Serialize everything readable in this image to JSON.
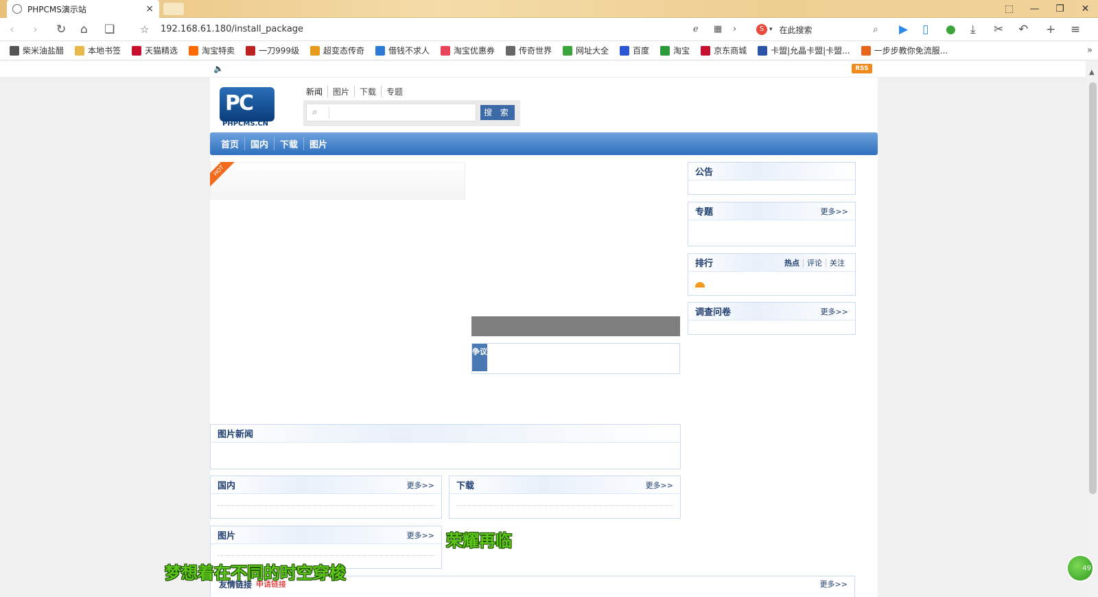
{
  "browser": {
    "tab_title": "PHPCMS演示站",
    "tab_close": "×",
    "url": "192.168.61.180/install_package",
    "search_placeholder": "在此搜索",
    "window_buttons": [
      "⬚",
      "—",
      "❐",
      "✕"
    ],
    "bookmarks": [
      {
        "label": "柴米油盐醋",
        "color": "#555"
      },
      {
        "label": "本地书签",
        "color": "#e8b84a"
      },
      {
        "label": "天猫精选",
        "color": "#c8102e"
      },
      {
        "label": "淘宝特卖",
        "color": "#ff6a00"
      },
      {
        "label": "一刀999级",
        "color": "#b22"
      },
      {
        "label": "超变态传奇",
        "color": "#e89a1c"
      },
      {
        "label": "借钱不求人",
        "color": "#2a7ad6"
      },
      {
        "label": "淘宝优惠券",
        "color": "#e8455a"
      },
      {
        "label": "传奇世界",
        "color": "#666"
      },
      {
        "label": "网址大全",
        "color": "#3aa53a"
      },
      {
        "label": "百度",
        "color": "#2a55d6"
      },
      {
        "label": "淘宝",
        "color": "#2a9a3a"
      },
      {
        "label": "京东商城",
        "color": "#c8102e"
      },
      {
        "label": "卡盟|允晶卡盟|卡盟...",
        "color": "#2a55a6"
      },
      {
        "label": "一步步教你免流服...",
        "color": "#e8651c"
      }
    ],
    "bookmarks_more": "»"
  },
  "site": {
    "rss": "RSS",
    "logo_text": "PHPCMS.CN",
    "logo_mark": "PC",
    "top_links": [
      "新闻",
      "图片",
      "下载",
      "专题"
    ],
    "search_button": "搜 索",
    "nav": [
      "首页",
      "国内",
      "下载",
      "图片"
    ],
    "hot_label": "HOT",
    "zhengyi_label": "争议",
    "right": {
      "notice": {
        "title": "公告"
      },
      "special": {
        "title": "专题",
        "more": "更多>>"
      },
      "ranking": {
        "title": "排行",
        "tabs": [
          "热点",
          "评论",
          "关注"
        ]
      },
      "survey": {
        "title": "调查问卷",
        "more": "更多>>"
      }
    },
    "photo_news": {
      "title": "图片新闻"
    },
    "domestic": {
      "title": "国内",
      "more": "更多>>"
    },
    "download": {
      "title": "下载",
      "more": "更多>>"
    },
    "pictures": {
      "title": "图片",
      "more": "更多>>"
    },
    "friend_links": {
      "title": "友情链接",
      "apply": "申请链接",
      "more": "更多>>"
    }
  },
  "overlay": {
    "text1": "荣耀再临",
    "text2": "梦想着在不同的时空穿梭",
    "badge": "49"
  }
}
